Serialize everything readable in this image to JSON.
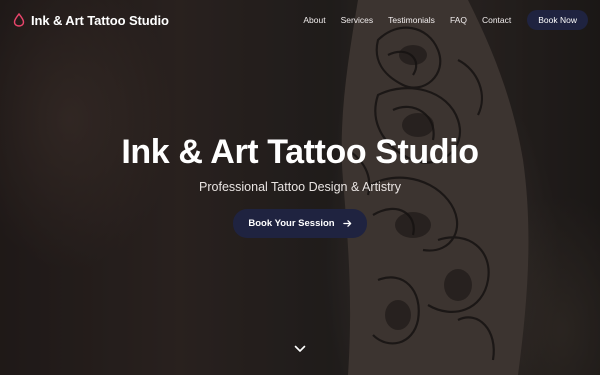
{
  "brand": {
    "name": "Ink & Art Tattoo Studio",
    "icon": "ink-drop-icon",
    "accent": "#e8456b"
  },
  "nav": {
    "links": [
      "About",
      "Services",
      "Testimonials",
      "FAQ",
      "Contact"
    ],
    "book_label": "Book Now"
  },
  "hero": {
    "title": "Ink & Art Tattoo Studio",
    "subtitle": "Professional Tattoo Design & Artistry",
    "cta_label": "Book Your Session",
    "cta_icon": "arrow-right-icon",
    "scroll_icon": "chevron-down-icon"
  },
  "colors": {
    "button_bg": "#1f2340",
    "text": "#ffffff"
  }
}
